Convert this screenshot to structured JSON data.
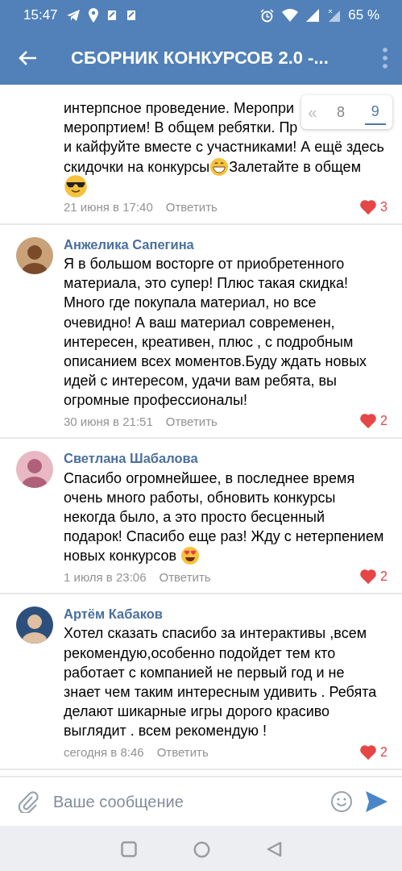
{
  "status_bar": {
    "time": "15:47",
    "battery": "65 %"
  },
  "toolbar": {
    "title": "СБОРНИК КОНКУРСОВ 2.0 -..."
  },
  "pager": {
    "first_label": "«",
    "pages": [
      {
        "label": "8",
        "selected": false
      },
      {
        "label": "9",
        "selected": true
      }
    ]
  },
  "comments": [
    {
      "lines": [
        [
          {
            "kind": "text",
            "text": "интерпсное проведение. Меропри"
          }
        ],
        [
          {
            "kind": "text",
            "text": "меропртием! В общем ребятки. Пр"
          }
        ],
        [
          {
            "kind": "text",
            "text": "и кайфуйте вместе с участниками! А ещё здесь"
          }
        ],
        [
          {
            "kind": "text",
            "text": "скидочки на конкурсы"
          },
          {
            "kind": "grin"
          },
          {
            "kind": "text",
            "text": "Залетайте в общем"
          }
        ],
        [
          {
            "kind": "sunglasses"
          }
        ]
      ],
      "date": "21 июня в 17:40",
      "reply": "Ответить",
      "likes": "3",
      "liked": true
    },
    {
      "author": "Анжелика Сапегина",
      "lines": [
        [
          {
            "kind": "text",
            "text": "Я в большом восторге от приобретенного"
          }
        ],
        [
          {
            "kind": "text",
            "text": "материала, это супер! Плюс такая скидка!"
          }
        ],
        [
          {
            "kind": "text",
            "text": "Много где покупала материал, но все"
          }
        ],
        [
          {
            "kind": "text",
            "text": "очевидно! А ваш материал современен,"
          }
        ],
        [
          {
            "kind": "text",
            "text": "интересен, креативен, плюс , с подробным"
          }
        ],
        [
          {
            "kind": "text",
            "text": "описанием всех моментов.Буду ждать новых"
          }
        ],
        [
          {
            "kind": "text",
            "text": "идей с интересом, удачи вам ребята, вы"
          }
        ],
        [
          {
            "kind": "text",
            "text": "огромные профессионалы!"
          }
        ]
      ],
      "date": "30 июня в 21:51",
      "reply": "Ответить",
      "likes": "2",
      "liked": true
    },
    {
      "author": "Светлана Шабалова",
      "lines": [
        [
          {
            "kind": "text",
            "text": "Спасибо огромнейшее, в последнее время"
          }
        ],
        [
          {
            "kind": "text",
            "text": "очень много работы, обновить конкурсы"
          }
        ],
        [
          {
            "kind": "text",
            "text": "некогда было, а это просто бесценный"
          }
        ],
        [
          {
            "kind": "text",
            "text": "подарок! Спасибо еще раз! Жду с нетерпением"
          }
        ],
        [
          {
            "kind": "text",
            "text": "новых конкурсов "
          },
          {
            "kind": "hearteyes"
          }
        ]
      ],
      "date": "1 июля в 23:06",
      "reply": "Ответить",
      "likes": "2",
      "liked": true
    },
    {
      "author": "Артём Кабаков",
      "lines": [
        [
          {
            "kind": "text",
            "text": "Хотел сказать спасибо за интерактивы ,всем"
          }
        ],
        [
          {
            "kind": "text",
            "text": "рекомендую,особенно подойдет тем кто"
          }
        ],
        [
          {
            "kind": "text",
            "text": "работает с компанией не первый год и не"
          }
        ],
        [
          {
            "kind": "text",
            "text": "знает чем таким интересным удивить . Ребята"
          }
        ],
        [
          {
            "kind": "text",
            "text": "делают шикарные игры дорого красиво"
          }
        ],
        [
          {
            "kind": "text",
            "text": "выглядит . всем рекомендую !"
          }
        ]
      ],
      "date": "сегодня в 8:46",
      "reply": "Ответить",
      "likes": "2",
      "liked": true
    }
  ],
  "composer": {
    "placeholder": "Ваше сообщение"
  }
}
